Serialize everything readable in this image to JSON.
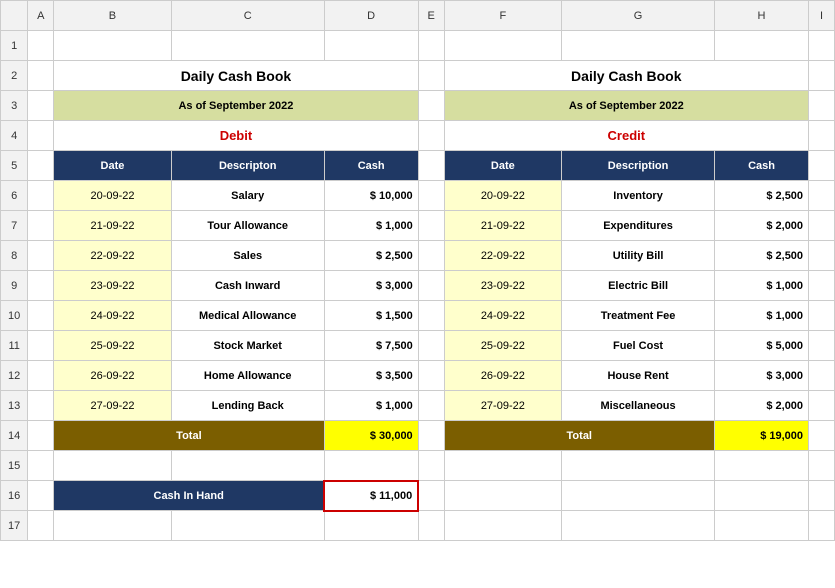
{
  "spreadsheet": {
    "title": "Daily Cash Book",
    "subtitle": "As of September 2022",
    "debit_label": "Debit",
    "credit_label": "Credit",
    "col_headers": {
      "date": "Date",
      "description_left": "Descripton",
      "cash_left": "Cash",
      "date_right": "Date",
      "description_right": "Description",
      "cash_right": "Cash"
    },
    "debit_rows": [
      {
        "date": "20-09-22",
        "description": "Salary",
        "cash": "$ 10,000"
      },
      {
        "date": "21-09-22",
        "description": "Tour Allowance",
        "cash": "$  1,000"
      },
      {
        "date": "22-09-22",
        "description": "Sales",
        "cash": "$  2,500"
      },
      {
        "date": "23-09-22",
        "description": "Cash Inward",
        "cash": "$  3,000"
      },
      {
        "date": "24-09-22",
        "description": "Medical Allowance",
        "cash": "$  1,500"
      },
      {
        "date": "25-09-22",
        "description": "Stock Market",
        "cash": "$  7,500"
      },
      {
        "date": "26-09-22",
        "description": "Home Allowance",
        "cash": "$  3,500"
      },
      {
        "date": "27-09-22",
        "description": "Lending Back",
        "cash": "$  1,000"
      }
    ],
    "credit_rows": [
      {
        "date": "20-09-22",
        "description": "Inventory",
        "cash": "$  2,500"
      },
      {
        "date": "21-09-22",
        "description": "Expenditures",
        "cash": "$  2,000"
      },
      {
        "date": "22-09-22",
        "description": "Utility Bill",
        "cash": "$  2,500"
      },
      {
        "date": "23-09-22",
        "description": "Electric Bill",
        "cash": "$  1,000"
      },
      {
        "date": "24-09-22",
        "description": "Treatment Fee",
        "cash": "$  1,000"
      },
      {
        "date": "25-09-22",
        "description": "Fuel Cost",
        "cash": "$  5,000"
      },
      {
        "date": "26-09-22",
        "description": "House Rent",
        "cash": "$  3,000"
      },
      {
        "date": "27-09-22",
        "description": "Miscellaneous",
        "cash": "$  2,000"
      }
    ],
    "debit_total_label": "Total",
    "debit_total_value": "$ 30,000",
    "credit_total_label": "Total",
    "credit_total_value": "$  19,000",
    "cash_hand_label": "Cash In Hand",
    "cash_hand_value": "$ 11,000",
    "row_numbers": [
      "",
      "1",
      "2",
      "3",
      "4",
      "5",
      "6",
      "7",
      "8",
      "9",
      "10",
      "11",
      "12",
      "13",
      "14",
      "15",
      "16",
      "17"
    ],
    "col_letters": [
      "A",
      "B",
      "C",
      "D",
      "E",
      "F",
      "G",
      "H",
      "I"
    ]
  }
}
